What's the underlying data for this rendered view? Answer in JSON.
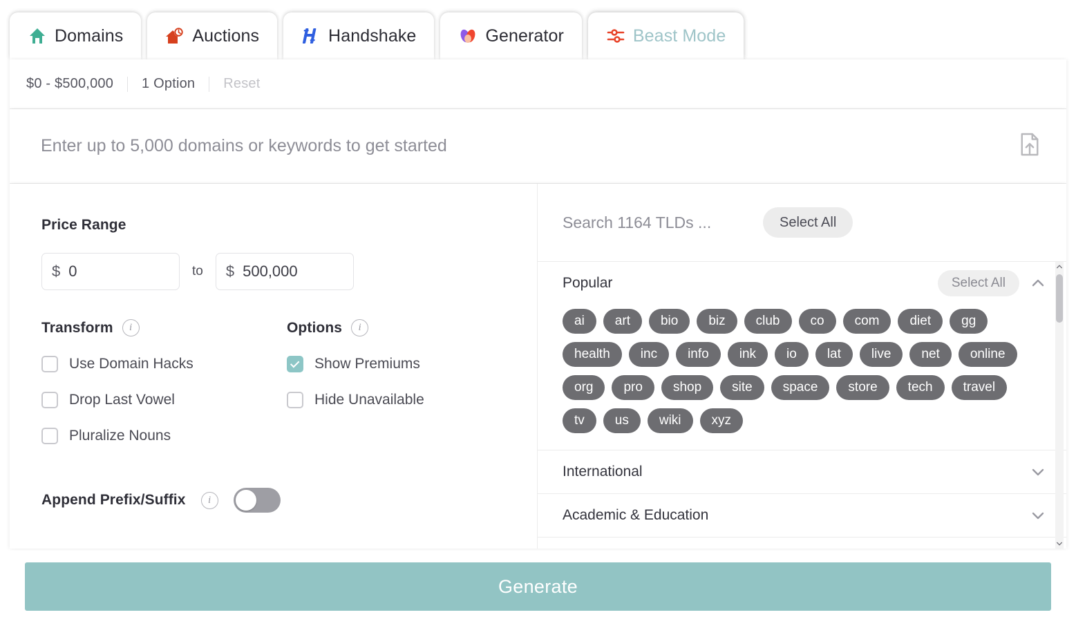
{
  "tabs": [
    {
      "label": "Domains",
      "icon": "house-icon",
      "active": false
    },
    {
      "label": "Auctions",
      "icon": "house-clock-icon",
      "active": false
    },
    {
      "label": "Handshake",
      "icon": "handshake-h-icon",
      "active": false
    },
    {
      "label": "Generator",
      "icon": "generator-pills-icon",
      "active": false
    },
    {
      "label": "Beast Mode",
      "icon": "sliders-icon",
      "active": true
    }
  ],
  "filterbar": {
    "price_summary": "$0 - $500,000",
    "option_count": "1 Option",
    "reset_label": "Reset"
  },
  "keyword_input": {
    "placeholder": "Enter up to 5,000 domains or keywords to get started",
    "value": "",
    "upload_icon": "file-upload-icon"
  },
  "left_panel": {
    "price_range": {
      "title": "Price Range",
      "currency_symbol": "$",
      "min_value": "0",
      "max_value": "500,000",
      "separator": "to"
    },
    "transform": {
      "title": "Transform",
      "info_icon": "info-icon",
      "items": [
        {
          "label": "Use Domain Hacks",
          "checked": false
        },
        {
          "label": "Drop Last Vowel",
          "checked": false
        },
        {
          "label": "Pluralize Nouns",
          "checked": false
        }
      ]
    },
    "options": {
      "title": "Options",
      "info_icon": "info-icon",
      "items": [
        {
          "label": "Show Premiums",
          "checked": true
        },
        {
          "label": "Hide Unavailable",
          "checked": false
        }
      ]
    },
    "append_prefix_suffix": {
      "label": "Append Prefix/Suffix",
      "info_icon": "info-icon",
      "enabled": false
    }
  },
  "right_panel": {
    "search_placeholder": "Search 1164 TLDs ...",
    "search_value": "",
    "select_all_label": "Select All",
    "groups": [
      {
        "title": "Popular",
        "select_all_label": "Select All",
        "expanded": true,
        "chips": [
          "ai",
          "art",
          "bio",
          "biz",
          "club",
          "co",
          "com",
          "diet",
          "gg",
          "health",
          "inc",
          "info",
          "ink",
          "io",
          "lat",
          "live",
          "net",
          "online",
          "org",
          "pro",
          "shop",
          "site",
          "space",
          "store",
          "tech",
          "travel",
          "tv",
          "us",
          "wiki",
          "xyz"
        ]
      },
      {
        "title": "International",
        "expanded": false,
        "chips": []
      },
      {
        "title": "Academic & Education",
        "expanded": false,
        "chips": []
      }
    ]
  },
  "generate_button": {
    "label": "Generate"
  },
  "colors": {
    "accent_teal": "#92c4c4",
    "chip_gray": "#6d6d71",
    "domains_green": "#3fae93",
    "auctions_red": "#d6401e",
    "handshake_blue": "#2f5fe0",
    "beast_red": "#e8442a"
  }
}
